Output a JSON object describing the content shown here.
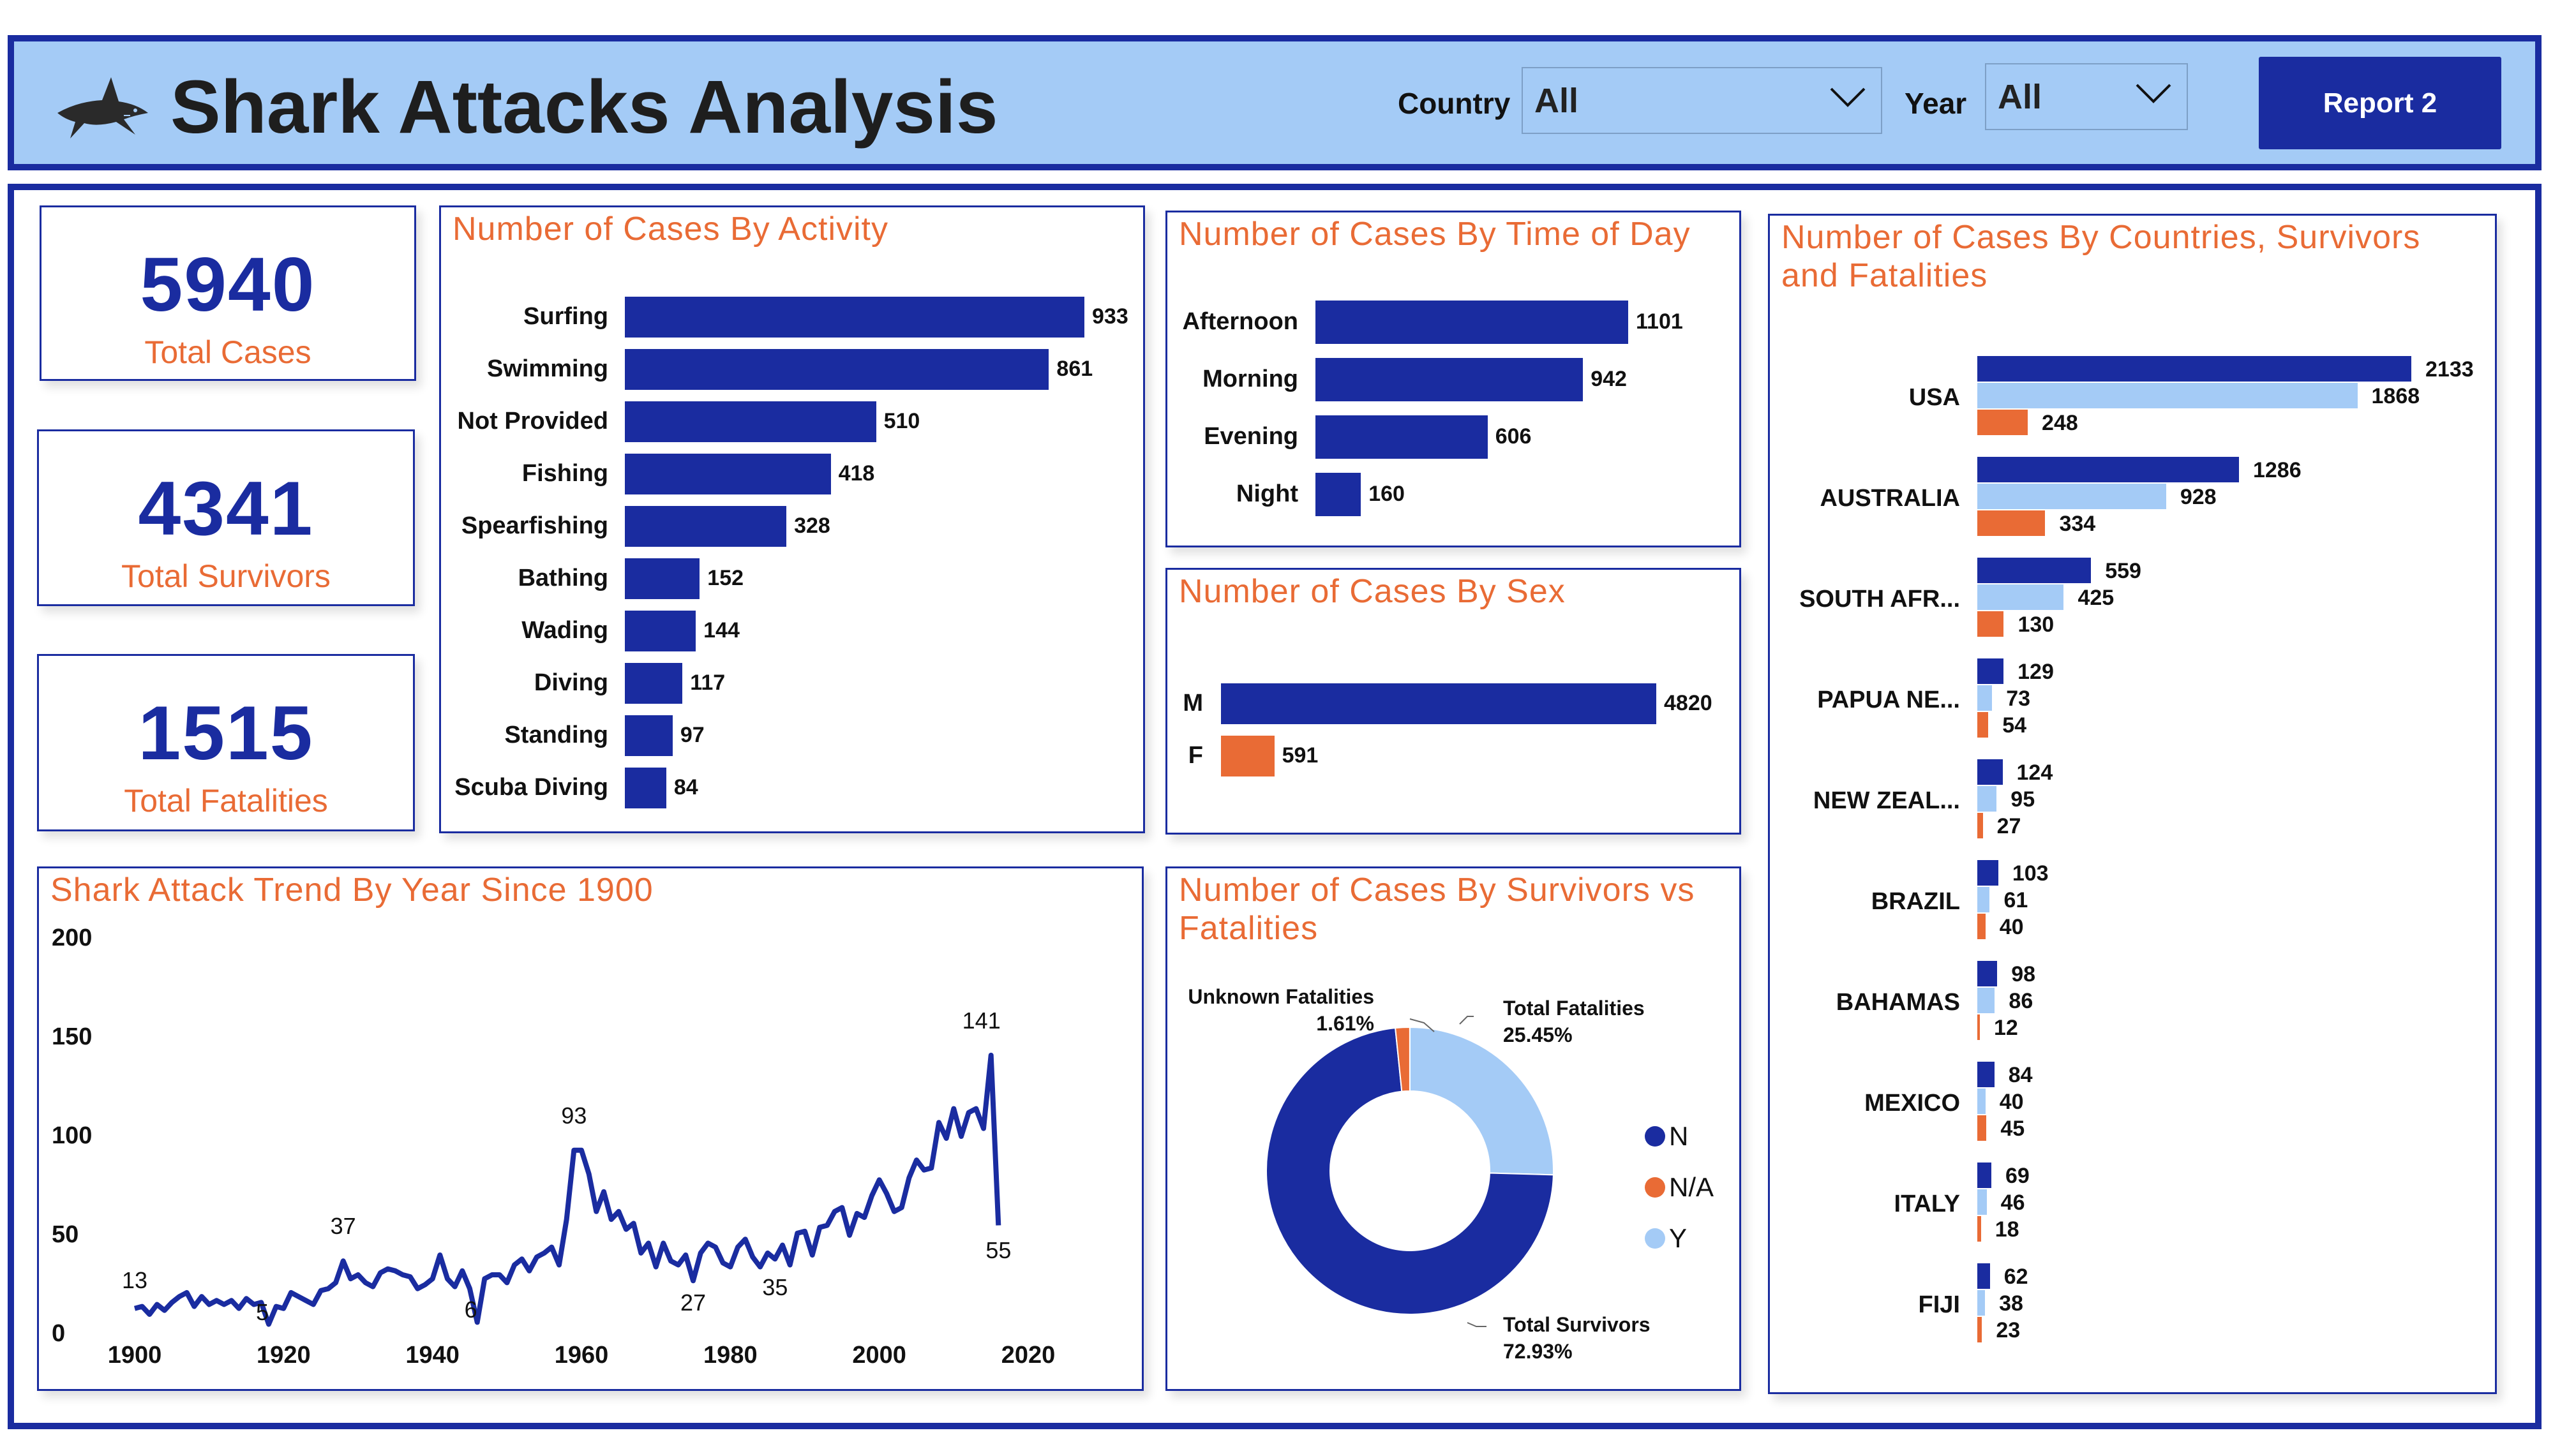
{
  "header": {
    "title": "Shark Attacks Analysis",
    "country_label": "Country",
    "country_value": "All",
    "year_label": "Year",
    "year_value": "All",
    "report_button": "Report 2",
    "logo_icon": "shark-icon"
  },
  "kpis": {
    "total_cases": {
      "value": "5940",
      "label": "Total Cases"
    },
    "total_survivors": {
      "value": "4341",
      "label": "Total Survivors"
    },
    "total_fatalities": {
      "value": "1515",
      "label": "Total Fatalities"
    }
  },
  "colors": {
    "navy": "#1a2ca0",
    "light_blue": "#a4cbf6",
    "orange": "#e96b35",
    "header_bg": "#a4cbf6"
  },
  "chart_data": [
    {
      "id": "activity",
      "type": "bar",
      "orientation": "horizontal",
      "title": "Number of Cases By Activity",
      "categories": [
        "Surfing",
        "Swimming",
        "Not Provided",
        "Fishing",
        "Spearfishing",
        "Bathing",
        "Wading",
        "Diving",
        "Standing",
        "Scuba Diving"
      ],
      "values": [
        933,
        861,
        510,
        418,
        328,
        152,
        144,
        117,
        97,
        84
      ]
    },
    {
      "id": "time_of_day",
      "type": "bar",
      "orientation": "horizontal",
      "title": "Number of Cases By Time of Day",
      "categories": [
        "Afternoon",
        "Morning",
        "Evening",
        "Night"
      ],
      "values": [
        1101,
        942,
        606,
        160
      ]
    },
    {
      "id": "sex",
      "type": "bar",
      "orientation": "horizontal",
      "title": "Number of Cases By Sex",
      "categories": [
        "M",
        "F"
      ],
      "values": [
        4820,
        591
      ],
      "colors": [
        "#1a2ca0",
        "#e96b35"
      ]
    },
    {
      "id": "trend",
      "type": "line",
      "title": "Shark Attack Trend By Year Since 1900",
      "xlim": [
        1900,
        2020
      ],
      "ylim": [
        0,
        200
      ],
      "x_ticks": [
        "1900",
        "1920",
        "1940",
        "1960",
        "1980",
        "2000",
        "2020"
      ],
      "y_ticks": [
        "0",
        "50",
        "100",
        "150",
        "200"
      ],
      "x": [
        1900,
        1901,
        1902,
        1903,
        1904,
        1905,
        1906,
        1907,
        1908,
        1909,
        1910,
        1911,
        1912,
        1913,
        1914,
        1915,
        1916,
        1917,
        1918,
        1919,
        1920,
        1921,
        1922,
        1923,
        1924,
        1925,
        1926,
        1927,
        1928,
        1929,
        1930,
        1931,
        1932,
        1933,
        1934,
        1935,
        1936,
        1937,
        1938,
        1939,
        1940,
        1941,
        1942,
        1943,
        1944,
        1945,
        1946,
        1947,
        1948,
        1949,
        1950,
        1951,
        1952,
        1953,
        1954,
        1955,
        1956,
        1957,
        1958,
        1959,
        1960,
        1961,
        1962,
        1963,
        1964,
        1965,
        1966,
        1967,
        1968,
        1969,
        1970,
        1971,
        1972,
        1973,
        1974,
        1975,
        1976,
        1977,
        1978,
        1979,
        1980,
        1981,
        1982,
        1983,
        1984,
        1985,
        1986,
        1987,
        1988,
        1989,
        1990,
        1991,
        1992,
        1993,
        1994,
        1995,
        1996,
        1997,
        1998,
        1999,
        2000,
        2001,
        2002,
        2003,
        2004,
        2005,
        2006,
        2007,
        2008,
        2009,
        2010,
        2011,
        2012,
        2013,
        2014,
        2015,
        2016
      ],
      "y": [
        13,
        14,
        10,
        15,
        12,
        16,
        19,
        21,
        14,
        19,
        15,
        17,
        15,
        17,
        13,
        18,
        15,
        16,
        5,
        14,
        13,
        21,
        19,
        17,
        15,
        22,
        23,
        26,
        37,
        28,
        30,
        26,
        24,
        31,
        33,
        32,
        30,
        29,
        23,
        25,
        28,
        40,
        28,
        24,
        32,
        23,
        6,
        28,
        30,
        30,
        26,
        35,
        38,
        32,
        39,
        41,
        44,
        35,
        58,
        93,
        93,
        81,
        62,
        72,
        58,
        62,
        53,
        56,
        41,
        46,
        34,
        46,
        37,
        35,
        40,
        27,
        41,
        46,
        44,
        36,
        34,
        44,
        48,
        39,
        34,
        41,
        38,
        45,
        35,
        51,
        52,
        40,
        54,
        55,
        62,
        64,
        50,
        61,
        59,
        70,
        78,
        71,
        62,
        64,
        79,
        88,
        83,
        84,
        107,
        99,
        114,
        100,
        112,
        114,
        104,
        141,
        55
      ],
      "point_labels": [
        {
          "x": 1900,
          "y": 13,
          "text": "13"
        },
        {
          "x": 1918,
          "y": 5,
          "text": "5"
        },
        {
          "x": 1928,
          "y": 37,
          "text": "37"
        },
        {
          "x": 1946,
          "y": 6,
          "text": "6"
        },
        {
          "x": 1959,
          "y": 93,
          "text": "93"
        },
        {
          "x": 1975,
          "y": 27,
          "text": "27"
        },
        {
          "x": 1986,
          "y": 35,
          "text": "35"
        },
        {
          "x": 2015,
          "y": 141,
          "text": "141"
        },
        {
          "x": 2016,
          "y": 55,
          "text": "55"
        }
      ]
    },
    {
      "id": "survivors_vs_fatalities",
      "type": "pie",
      "title": "Number of Cases By Survivors vs Fatalities",
      "slices": [
        {
          "name": "N",
          "label": "Total Survivors",
          "percent": 72.93,
          "percent_text": "72.93%",
          "color": "#1a2ca0"
        },
        {
          "name": "N/A",
          "label": "Unknown Fatalities",
          "percent": 1.61,
          "percent_text": "1.61%",
          "color": "#e96b35"
        },
        {
          "name": "Y",
          "label": "Total Fatalities",
          "percent": 25.45,
          "percent_text": "25.45%",
          "color": "#a4cbf6"
        }
      ],
      "legend": [
        "N",
        "N/A",
        "Y"
      ]
    },
    {
      "id": "countries",
      "type": "bar",
      "orientation": "horizontal",
      "title": "Number of Cases By Countries, Survivors and Fatalities",
      "categories": [
        "USA",
        "AUSTRALIA",
        "SOUTH AFR...",
        "PAPUA NE...",
        "NEW ZEAL...",
        "BRAZIL",
        "BAHAMAS",
        "MEXICO",
        "ITALY",
        "FIJI"
      ],
      "series": [
        {
          "values": [
            2133,
            1286,
            559,
            129,
            124,
            103,
            98,
            84,
            69,
            62
          ],
          "color": "#1a2ca0"
        },
        {
          "values": [
            1868,
            928,
            425,
            73,
            95,
            61,
            86,
            40,
            46,
            38
          ],
          "color": "#a4cbf6"
        },
        {
          "values": [
            248,
            334,
            130,
            54,
            27,
            40,
            12,
            45,
            18,
            23
          ],
          "color": "#e96b35"
        }
      ]
    }
  ]
}
